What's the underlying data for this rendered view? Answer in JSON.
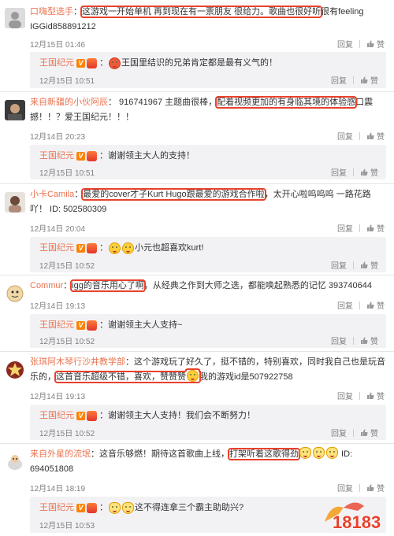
{
  "action_labels": {
    "reply": "回复",
    "like": "赞"
  },
  "comments": [
    {
      "user": "口嗨型选手",
      "sep": "：",
      "text_highlight": "这游戏一开始单机 再到现在有一票朋友 很给力。歌曲也很好听",
      "text_rest": "很有feeling  IGGid858891212",
      "time": "12月15日 01:46",
      "reply": {
        "user": "王国纪元",
        "text": "王国里结识的兄弟肯定都是最有义气的！",
        "time": "12月15日 10:51"
      }
    },
    {
      "user": "来自新疆的小伙阿辰",
      "sep": "：",
      "text_before": " 916741967 主题曲很棒，",
      "text_highlight": "配着视频更加的有身临其境的体验感",
      "text_rest": "口震撼！！？爱王国纪元！！！",
      "time": "12月14日 20:23",
      "reply": {
        "user": "王国纪元",
        "text": "谢谢领主大人的支持！",
        "time": "12月15日 10:51"
      }
    },
    {
      "user": "小卡Camila",
      "sep": "：",
      "text_highlight": "最爱的cover才子Kurt Hugo跟最爱的游戏合作啦",
      "text_rest": "，太开心啦呜呜呜 一路花路吖！ ID: 502580309",
      "time": "12月14日 20:04",
      "reply": {
        "user": "王国纪元",
        "text": "小元也超喜欢kurt!",
        "time": "12月15日 10:52"
      }
    },
    {
      "user": "Commur",
      "sep": "：",
      "text_highlight": "igg的音乐用心了啊",
      "text_rest": "，从经典之作到大师之选，都能唤起熟悉的记忆  393740644",
      "time": "12月14日 19:13",
      "reply": {
        "user": "王国纪元",
        "text": "谢谢领主大人支持~",
        "time": "12月15日 10:52"
      }
    },
    {
      "user": "张琪阿木琴行沙井教学部",
      "sep": "：",
      "text_before": "这个游戏玩了好久了，挺不错的，特别喜欢，同时我自己也是玩音乐的，",
      "text_highlight": "这首音乐超级不错，喜欢，赞赞赞",
      "text_rest": "我的游戏id是507922758",
      "time": "12月14日 19:13",
      "reply": {
        "user": "王国纪元",
        "text": "谢谢领主大人支持！我们会不断努力！",
        "time": "12月15日 10:52"
      }
    },
    {
      "user": "来自外星的流氓",
      "sep": "：",
      "text_before": "这音乐够燃！期待这首歌曲上线，",
      "text_highlight": "打架听着这歌得劲",
      "text_rest": " ID: 694051808",
      "time": "12月14日 18:19",
      "reply": {
        "user": "王国纪元",
        "text": "这不得连拿三个霸主助助兴?",
        "time": "12月15日 10:53"
      }
    }
  ],
  "watermark": "18183",
  "colors": {
    "username": "#eb7350",
    "highlight": "#e8412c",
    "reply_bg": "#f2f2f5",
    "muted": "#808080"
  }
}
